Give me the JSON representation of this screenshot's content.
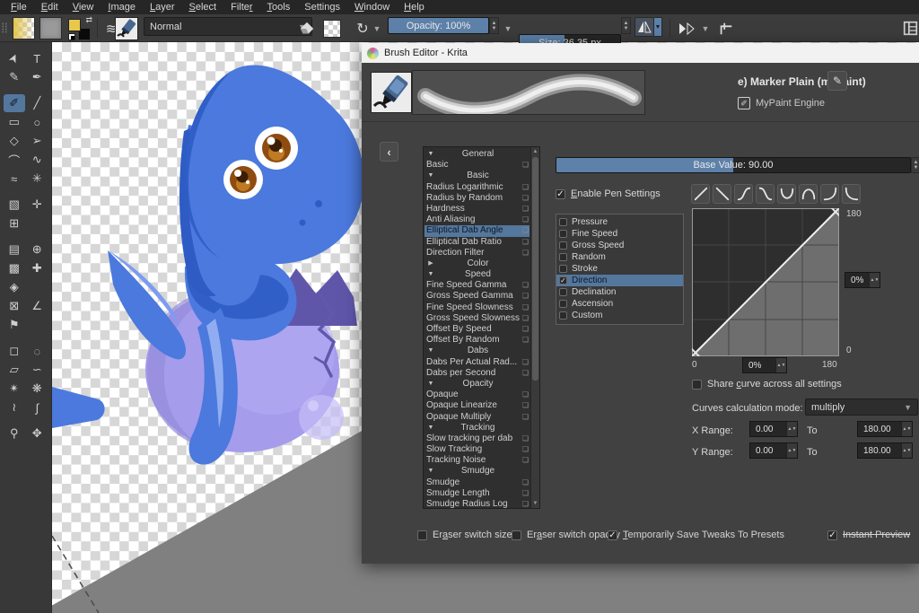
{
  "menu": {
    "items": [
      {
        "label": "File",
        "mnemonic": 0
      },
      {
        "label": "Edit",
        "mnemonic": 0
      },
      {
        "label": "View",
        "mnemonic": 0
      },
      {
        "label": "Image",
        "mnemonic": 0
      },
      {
        "label": "Layer",
        "mnemonic": 0
      },
      {
        "label": "Select",
        "mnemonic": 0
      },
      {
        "label": "Filter",
        "mnemonic": 5
      },
      {
        "label": "Tools",
        "mnemonic": 0
      },
      {
        "label": "Settings",
        "mnemonic": 6
      },
      {
        "label": "Window",
        "mnemonic": 0
      },
      {
        "label": "Help",
        "mnemonic": 0
      }
    ]
  },
  "toolbar": {
    "blending_mode": "Normal",
    "opacity_label": "Opacity: 100%",
    "size_label": "Size: 36.35 px"
  },
  "toolbox": {
    "tools": [
      {
        "name": "select-shapes-tool",
        "glyph": "➤",
        "rot": true
      },
      {
        "name": "text-tool",
        "glyph": "T"
      },
      {
        "name": "edit-shapes-tool",
        "glyph": "✎"
      },
      {
        "name": "calligraphy-tool",
        "glyph": "✒"
      },
      {
        "name": "freehand-brush-tool",
        "glyph": "✐",
        "selected": true,
        "group": true
      },
      {
        "name": "line-tool",
        "glyph": "╱"
      },
      {
        "name": "rectangle-tool",
        "glyph": "▭"
      },
      {
        "name": "ellipse-tool",
        "glyph": "○"
      },
      {
        "name": "polygon-tool",
        "glyph": "◇"
      },
      {
        "name": "polyline-tool",
        "glyph": "➢"
      },
      {
        "name": "bezier-curve-tool",
        "glyph": "⌒"
      },
      {
        "name": "freehand-path-tool",
        "glyph": "∿"
      },
      {
        "name": "dynamic-brush-tool",
        "glyph": "≈"
      },
      {
        "name": "multibrush-tool",
        "glyph": "✳"
      },
      {
        "name": "transform-tool",
        "glyph": "▧",
        "group": true
      },
      {
        "name": "move-tool",
        "glyph": "✛"
      },
      {
        "name": "crop-tool",
        "glyph": "⊞"
      },
      {
        "name": "",
        "glyph": ""
      },
      {
        "name": "gradient-tool",
        "glyph": "▤",
        "group": true
      },
      {
        "name": "color-sampler-tool",
        "glyph": "⊕"
      },
      {
        "name": "pattern-edit-tool",
        "glyph": "▩"
      },
      {
        "name": "smart-patch-tool",
        "glyph": "✚"
      },
      {
        "name": "fill-tool",
        "glyph": "◈"
      },
      {
        "name": "",
        "glyph": ""
      },
      {
        "name": "enclose-fill-tool",
        "glyph": "⊠"
      },
      {
        "name": "measure-tool",
        "glyph": "∠"
      },
      {
        "name": "reference-images-tool",
        "glyph": "⚑"
      },
      {
        "name": "",
        "glyph": ""
      },
      {
        "name": "rect-select-tool",
        "glyph": "◻",
        "group": true
      },
      {
        "name": "ellipse-select-tool",
        "glyph": "◌"
      },
      {
        "name": "polygon-select-tool",
        "glyph": "▱"
      },
      {
        "name": "freehand-select-tool",
        "glyph": "∽"
      },
      {
        "name": "contiguous-select-tool",
        "glyph": "✴"
      },
      {
        "name": "similar-select-tool",
        "glyph": "❋"
      },
      {
        "name": "bezier-select-tool",
        "glyph": "≀"
      },
      {
        "name": "magnetic-select-tool",
        "glyph": "∫"
      },
      {
        "name": "zoom-tool",
        "glyph": "⚲",
        "group": true
      },
      {
        "name": "pan-tool",
        "glyph": "✥"
      }
    ]
  },
  "dialog": {
    "title": "Brush Editor - Krita",
    "preset_name": "e) Marker Plain (mypaint)",
    "engine": "MyPaint Engine",
    "base_value_label": "Base Value: 90.00",
    "enable_pen_settings": {
      "label": "Enable Pen Settings",
      "mnemonic": 0,
      "checked": true
    },
    "curve_buttons": [
      {
        "name": "curve-linear-up"
      },
      {
        "name": "curve-linear-down"
      },
      {
        "name": "curve-ease-up"
      },
      {
        "name": "curve-ease-down"
      },
      {
        "name": "curve-u-shape"
      },
      {
        "name": "curve-arch-shape"
      },
      {
        "name": "curve-j-shape"
      },
      {
        "name": "curve-l-shape"
      }
    ],
    "settings": [
      {
        "type": "header",
        "open": true,
        "label": "General"
      },
      {
        "type": "item",
        "label": "Basic"
      },
      {
        "type": "header",
        "open": true,
        "label": "Basic"
      },
      {
        "type": "item",
        "label": "Radius Logarithmic"
      },
      {
        "type": "item",
        "label": "Radius by Random"
      },
      {
        "type": "item",
        "label": "Hardness"
      },
      {
        "type": "item",
        "label": "Anti Aliasing"
      },
      {
        "type": "item",
        "label": "Elliptical Dab Angle",
        "selected": true
      },
      {
        "type": "item",
        "label": "Elliptical Dab Ratio"
      },
      {
        "type": "item",
        "label": "Direction Filter"
      },
      {
        "type": "header",
        "open": false,
        "label": "Color"
      },
      {
        "type": "header",
        "open": true,
        "label": "Speed"
      },
      {
        "type": "item",
        "label": "Fine Speed Gamma"
      },
      {
        "type": "item",
        "label": "Gross Speed Gamma"
      },
      {
        "type": "item",
        "label": "Fine Speed Slowness"
      },
      {
        "type": "item",
        "label": "Gross Speed Slowness"
      },
      {
        "type": "item",
        "label": "Offset By Speed"
      },
      {
        "type": "item",
        "label": "Offset By Random"
      },
      {
        "type": "header",
        "open": true,
        "label": "Dabs"
      },
      {
        "type": "item",
        "label": "Dabs Per Actual Rad..."
      },
      {
        "type": "item",
        "label": "Dabs per Second"
      },
      {
        "type": "header",
        "open": true,
        "label": "Opacity"
      },
      {
        "type": "item",
        "label": "Opaque"
      },
      {
        "type": "item",
        "label": "Opaque Linearize"
      },
      {
        "type": "item",
        "label": "Opaque Multiply"
      },
      {
        "type": "header",
        "open": true,
        "label": "Tracking"
      },
      {
        "type": "item",
        "label": "Slow tracking per dab"
      },
      {
        "type": "item",
        "label": "Slow Tracking"
      },
      {
        "type": "item",
        "label": "Tracking Noise"
      },
      {
        "type": "header",
        "open": true,
        "label": "Smudge"
      },
      {
        "type": "item",
        "label": "Smudge"
      },
      {
        "type": "item",
        "label": "Smudge Length"
      },
      {
        "type": "item",
        "label": "Smudge Radius Log"
      }
    ],
    "sensors": [
      {
        "label": "Pressure",
        "checked": false
      },
      {
        "label": "Fine Speed",
        "checked": false
      },
      {
        "label": "Gross Speed",
        "checked": false
      },
      {
        "label": "Random",
        "checked": false
      },
      {
        "label": "Stroke",
        "checked": false
      },
      {
        "label": "Direction",
        "checked": true,
        "selected": true
      },
      {
        "label": "Declination",
        "checked": false
      },
      {
        "label": "Ascension",
        "checked": false
      },
      {
        "label": "Custom",
        "checked": false
      }
    ],
    "curve": {
      "y_max": "180",
      "y_min": "0",
      "x_min": "0",
      "x_max": "180",
      "x_value": "0%",
      "y_value": "0%"
    },
    "share_curve": {
      "label": "Share curve across all settings",
      "mnemonic": 6,
      "checked": false
    },
    "calc_mode_label": "Curves calculation mode:",
    "calc_mode_value": "multiply",
    "x_range_label": "X Range:",
    "y_range_label": "Y Range:",
    "to_label": "To",
    "x_from": "0.00",
    "x_to": "180.00",
    "y_from": "0.00",
    "y_to": "180.00",
    "footer": [
      {
        "label": "Eraser switch size",
        "mnemonic": 2,
        "checked": false
      },
      {
        "label": "Eraser switch opacity",
        "mnemonic": 2,
        "checked": false
      },
      {
        "label": "Temporarily Save Tweaks To Presets",
        "mnemonic": 0,
        "checked": true
      },
      {
        "label": "Instant Preview",
        "mnemonic": null,
        "checked": true,
        "strikethrough": true
      }
    ]
  },
  "colors": {
    "accent_blue": "#5d81a8",
    "selection_blue": "#54779e",
    "canvas_outside_gray": "#808080",
    "foreground_color": "#e8c84a",
    "background_color": "#0a0a0a"
  }
}
